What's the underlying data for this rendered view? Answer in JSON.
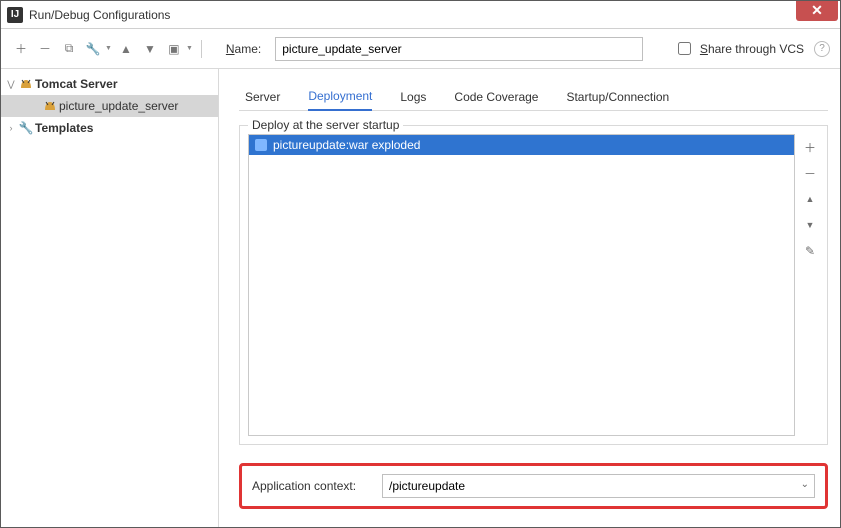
{
  "window": {
    "title": "Run/Debug Configurations"
  },
  "toolbar": {
    "name_label": "Name:",
    "name_value": "picture_update_server",
    "share_label": "Share through VCS"
  },
  "sidebar": {
    "items": [
      {
        "label": "Tomcat Server",
        "bold": true,
        "icon": "tomcat",
        "expanded": true,
        "children": [
          {
            "label": "picture_update_server",
            "icon": "tomcat",
            "selected": true
          }
        ]
      },
      {
        "label": "Templates",
        "bold": true,
        "icon": "wrench",
        "expanded": false
      }
    ]
  },
  "tabs": [
    {
      "label": "Server",
      "active": false
    },
    {
      "label": "Deployment",
      "active": true
    },
    {
      "label": "Logs",
      "active": false
    },
    {
      "label": "Code Coverage",
      "active": false
    },
    {
      "label": "Startup/Connection",
      "active": false
    }
  ],
  "deployment": {
    "legend": "Deploy at the server startup",
    "items": [
      {
        "label": "pictureupdate:war exploded",
        "selected": true
      }
    ],
    "context_label": "Application context:",
    "context_value": "/pictureupdate"
  }
}
